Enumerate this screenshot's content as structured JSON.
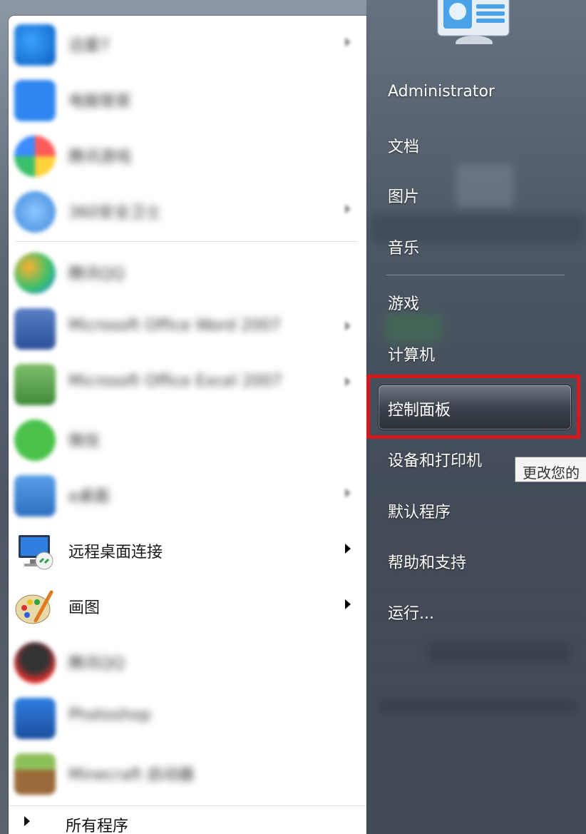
{
  "start_menu": {
    "programs": [
      {
        "label": "迅雷7",
        "blurred": true,
        "has_submenu": true,
        "icon": "thunder-icon"
      },
      {
        "label": "电脑管家",
        "blurred": true,
        "has_submenu": false,
        "icon": "pc-manager-icon"
      },
      {
        "label": "腾讯游戏",
        "blurred": true,
        "has_submenu": false,
        "icon": "colorful-icon"
      },
      {
        "label": "360安全卫士",
        "blurred": true,
        "has_submenu": true,
        "icon": "browser-icon"
      },
      {
        "label": "腾讯QQ",
        "blurred": true,
        "has_submenu": false,
        "icon": "chat-icon"
      },
      {
        "label": "Microsoft Office Word 2007",
        "blurred": true,
        "has_submenu": true,
        "icon": "word-icon"
      },
      {
        "label": "Microsoft Office Excel 2007",
        "blurred": true,
        "has_submenu": true,
        "icon": "excel-icon"
      },
      {
        "label": "微信",
        "blurred": true,
        "has_submenu": false,
        "icon": "wechat-icon"
      },
      {
        "label": "e桌面",
        "blurred": true,
        "has_submenu": true,
        "icon": "calendar-icon"
      },
      {
        "label": "远程桌面连接",
        "blurred": false,
        "has_submenu": true,
        "icon": "remote-desktop-icon"
      },
      {
        "label": "画图",
        "blurred": false,
        "has_submenu": true,
        "icon": "paint-icon"
      },
      {
        "label": "腾讯QQ",
        "blurred": true,
        "has_submenu": false,
        "icon": "qq-icon"
      },
      {
        "label": "Photoshop",
        "blurred": true,
        "has_submenu": false,
        "icon": "photoshop-icon"
      },
      {
        "label": "Minecraft 启动器",
        "blurred": true,
        "has_submenu": false,
        "icon": "minecraft-icon"
      }
    ],
    "all_programs_label": "所有程序",
    "user": {
      "name": "Administrator"
    },
    "right_items_top": [
      "文档",
      "图片",
      "音乐"
    ],
    "right_items_mid": [
      "游戏",
      "计算机"
    ],
    "highlighted_item": "控制面板",
    "right_items_bottom": [
      "设备和打印机",
      "默认程序",
      "帮助和支持",
      "运行..."
    ],
    "tooltip": "更改您的",
    "highlight_color": "#d8181f"
  }
}
